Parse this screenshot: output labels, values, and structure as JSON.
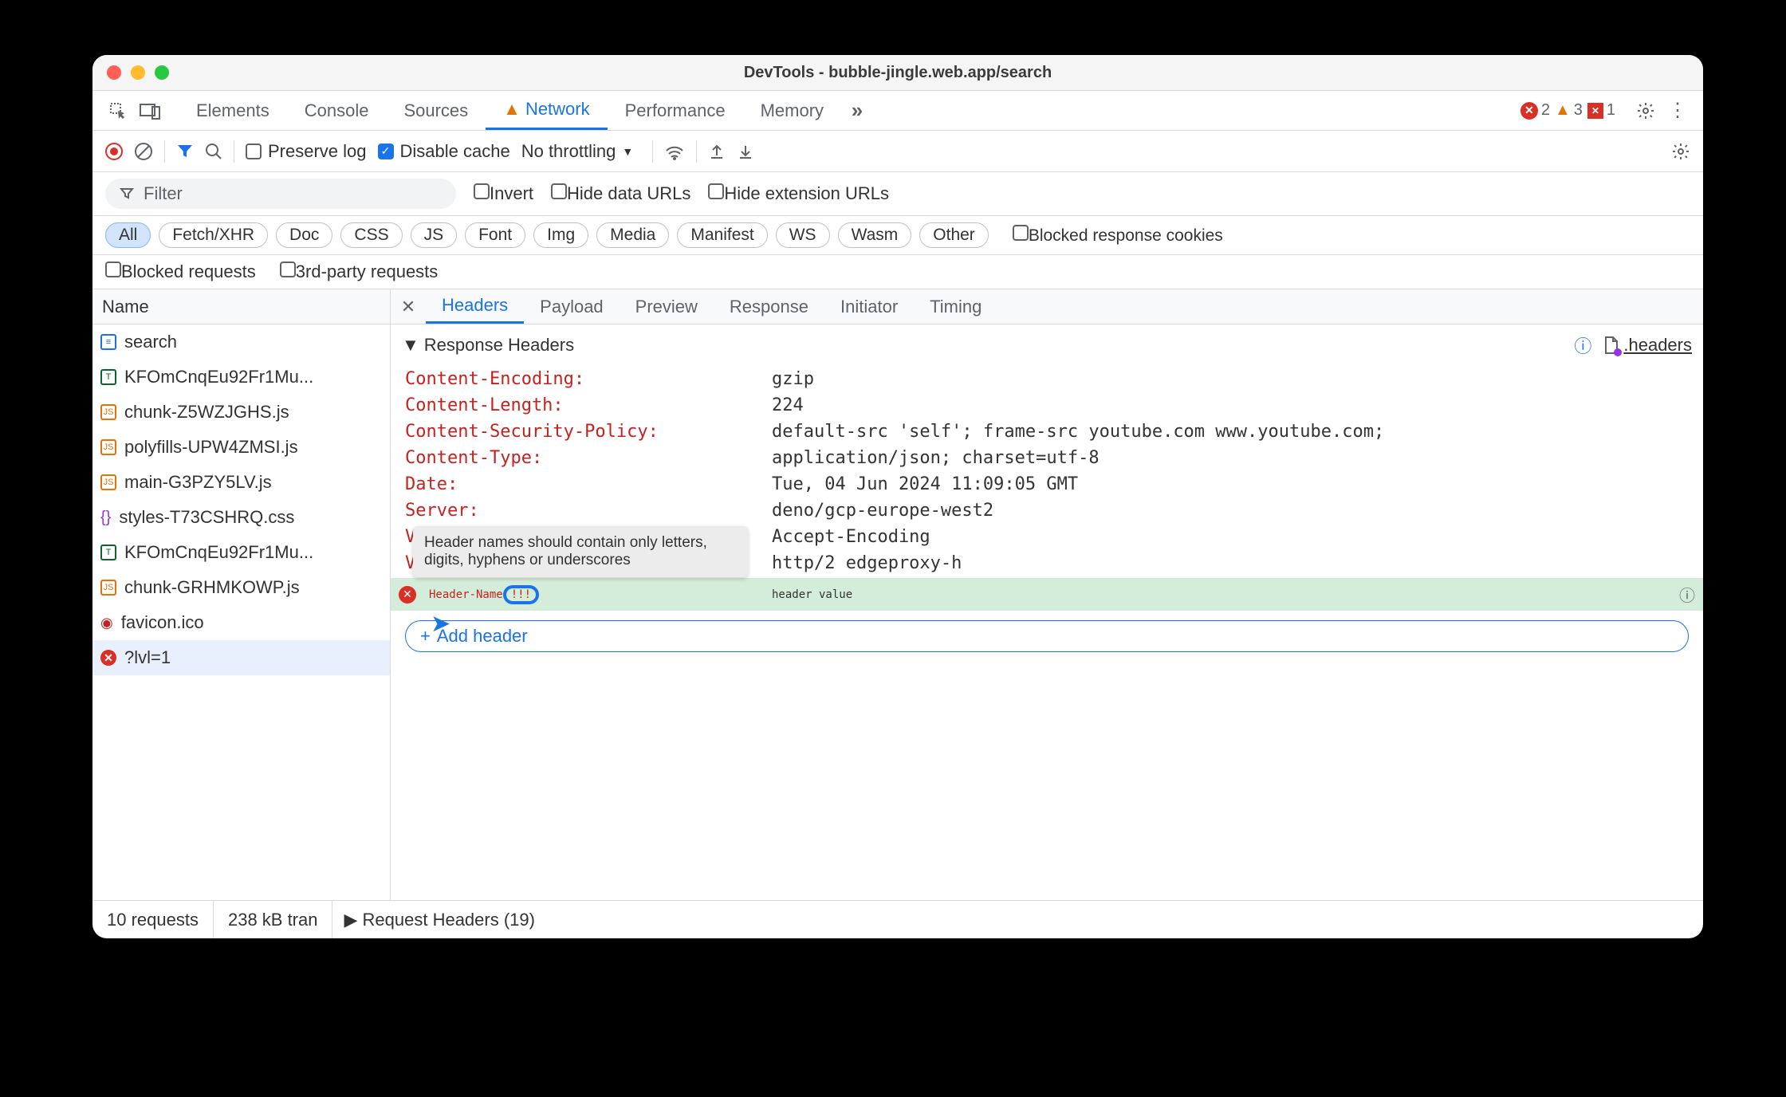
{
  "window": {
    "title": "DevTools - bubble-jingle.web.app/search"
  },
  "tabs": {
    "items": [
      "Elements",
      "Console",
      "Sources",
      "Network",
      "Performance",
      "Memory"
    ],
    "active": "Network"
  },
  "counts": {
    "errors": "2",
    "warnings": "3",
    "blocked": "1"
  },
  "toolbar": {
    "preserve_log": "Preserve log",
    "disable_cache": "Disable cache",
    "throttling": "No throttling"
  },
  "filter": {
    "placeholder": "Filter",
    "invert": "Invert",
    "hide_data": "Hide data URLs",
    "hide_ext": "Hide extension URLs"
  },
  "types": [
    "All",
    "Fetch/XHR",
    "Doc",
    "CSS",
    "JS",
    "Font",
    "Img",
    "Media",
    "Manifest",
    "WS",
    "Wasm",
    "Other"
  ],
  "type_checks": {
    "blocked_cookies": "Blocked response cookies",
    "blocked_requests": "Blocked requests",
    "third_party": "3rd-party requests"
  },
  "requests": {
    "header": "Name",
    "items": [
      {
        "name": "search",
        "icon": "doc"
      },
      {
        "name": "KFOmCnqEu92Fr1Mu...",
        "icon": "txt"
      },
      {
        "name": "chunk-Z5WZJGHS.js",
        "icon": "js"
      },
      {
        "name": "polyfills-UPW4ZMSI.js",
        "icon": "js"
      },
      {
        "name": "main-G3PZY5LV.js",
        "icon": "js"
      },
      {
        "name": "styles-T73CSHRQ.css",
        "icon": "css"
      },
      {
        "name": "KFOmCnqEu92Fr1Mu...",
        "icon": "txt"
      },
      {
        "name": "chunk-GRHMKOWP.js",
        "icon": "js"
      },
      {
        "name": "favicon.ico",
        "icon": "img"
      },
      {
        "name": "?lvl=1",
        "icon": "err",
        "selected": true
      }
    ]
  },
  "detail_tabs": [
    "Headers",
    "Payload",
    "Preview",
    "Response",
    "Initiator",
    "Timing"
  ],
  "detail_active": "Headers",
  "response_section": {
    "title": "Response Headers",
    "override_link": ".headers"
  },
  "response_headers": [
    {
      "name": "Content-Encoding:",
      "value": "gzip"
    },
    {
      "name": "Content-Length:",
      "value": "224"
    },
    {
      "name": "Content-Security-Policy:",
      "value": "default-src 'self'; frame-src youtube.com www.youtube.com;"
    },
    {
      "name": "Content-Type:",
      "value": "application/json; charset=utf-8"
    },
    {
      "name": "Date:",
      "value": "Tue, 04 Jun 2024 11:09:05 GMT"
    },
    {
      "name": "Server:",
      "value": "deno/gcp-europe-west2"
    },
    {
      "name": "Vary:",
      "value": "Accept-Encoding"
    },
    {
      "name": "Via:",
      "value": "http/2 edgeproxy-h"
    }
  ],
  "new_header": {
    "name_prefix": "Header-Name",
    "name_invalid": "!!!",
    "value": "header value",
    "tooltip": "Header names should contain only letters, digits, hyphens or underscores"
  },
  "add_header_btn": "Add header",
  "request_headers_title": "Request Headers (19)",
  "footer": {
    "requests": "10 requests",
    "transferred": "238 kB tran"
  }
}
